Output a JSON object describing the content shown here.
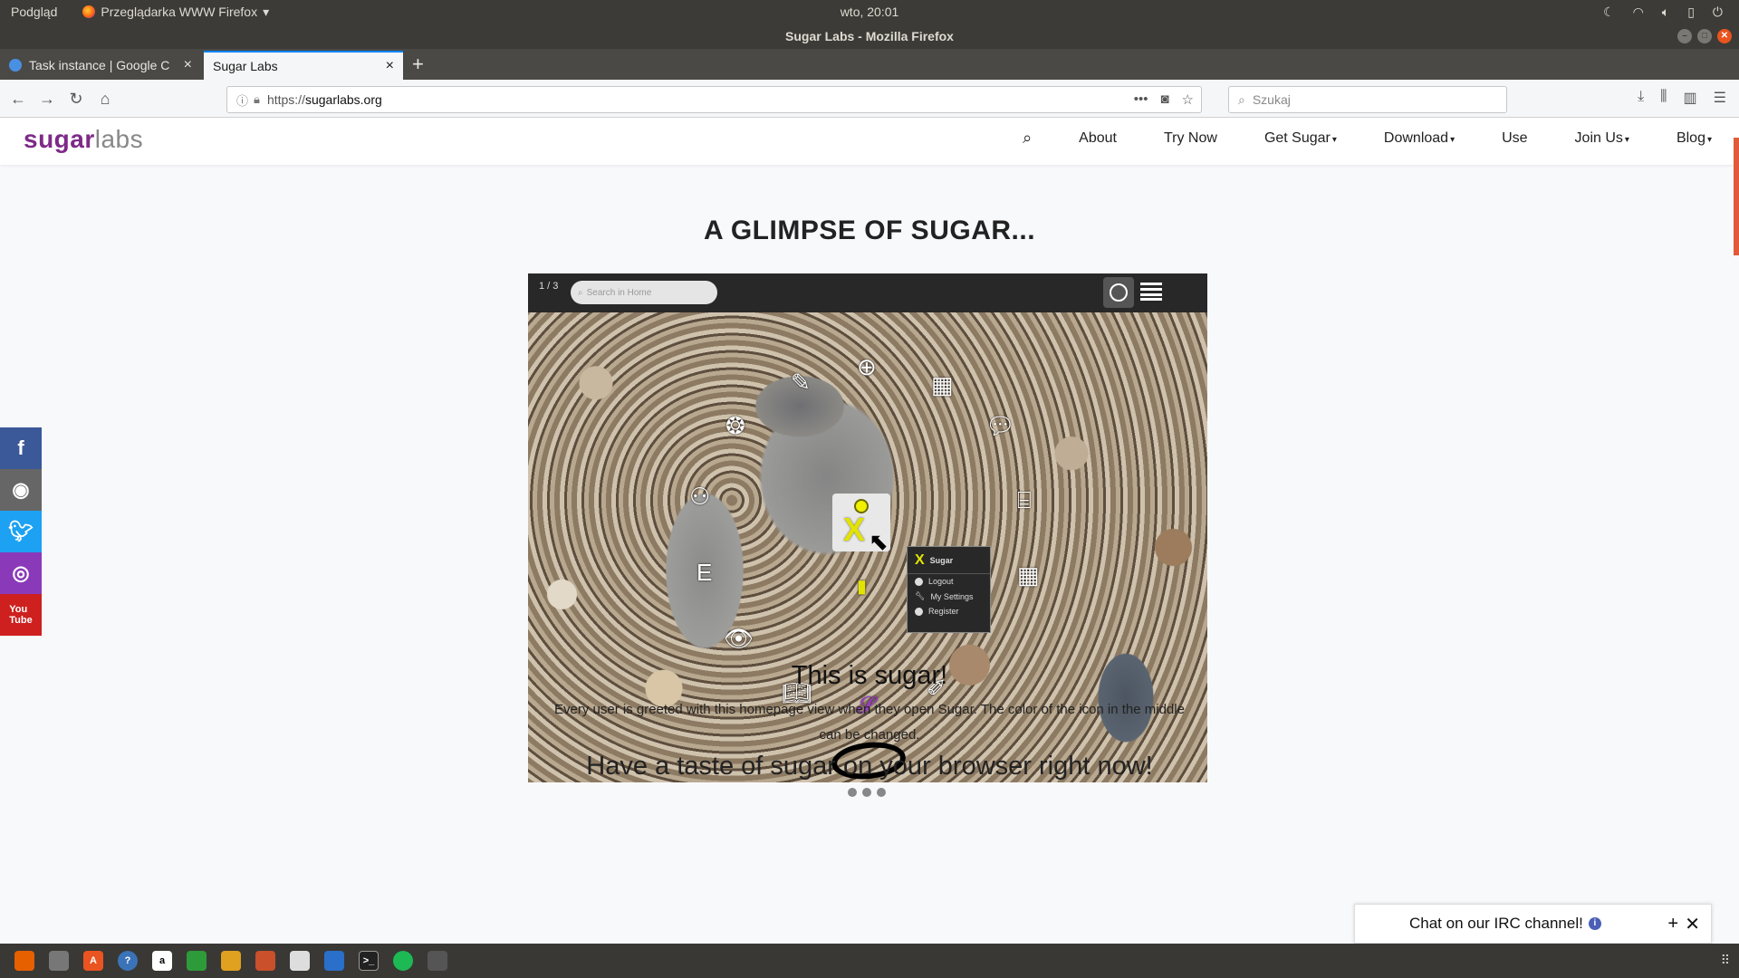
{
  "os": {
    "app_menu": "Podgląd",
    "active_app": "Przeglądarka WWW Firefox",
    "clock": "wto, 20:01",
    "window_title": "Sugar Labs - Mozilla Firefox"
  },
  "browser": {
    "tabs": [
      {
        "label": "Task instance | Google C"
      },
      {
        "label": "Sugar Labs"
      }
    ],
    "url_scheme": "https://",
    "url_host": "sugarlabs.org",
    "search_placeholder": "Szukaj"
  },
  "site": {
    "logo_part1": "sugar",
    "logo_part2": "labs",
    "nav": [
      {
        "label": "About"
      },
      {
        "label": "Try Now"
      },
      {
        "label": "Get Sugar"
      },
      {
        "label": "Download"
      },
      {
        "label": "Use"
      },
      {
        "label": "Join Us"
      },
      {
        "label": "Blog"
      }
    ],
    "section_title": "A GLIMPSE OF SUGAR...",
    "slide": {
      "counter": "1 / 3",
      "search_placeholder": "Search in Home",
      "menu_title": "Sugar",
      "menu_items": [
        "Logout",
        "My Settings",
        "Register"
      ]
    },
    "slide_title": "This is sugar!",
    "slide_description": "Every user is greeted with this homepage view when they open Sugar. The color of the icon in the middle can be changed.",
    "next_heading": "Have a taste of sugar on your browser right now!",
    "irc_label": "Chat on our IRC channel!",
    "social": [
      "facebook",
      "github",
      "twitter",
      "instagram",
      "youtube"
    ]
  },
  "colors": {
    "brand_purple": "#7d2a87",
    "firefox_tab_accent": "#0a84ff"
  }
}
